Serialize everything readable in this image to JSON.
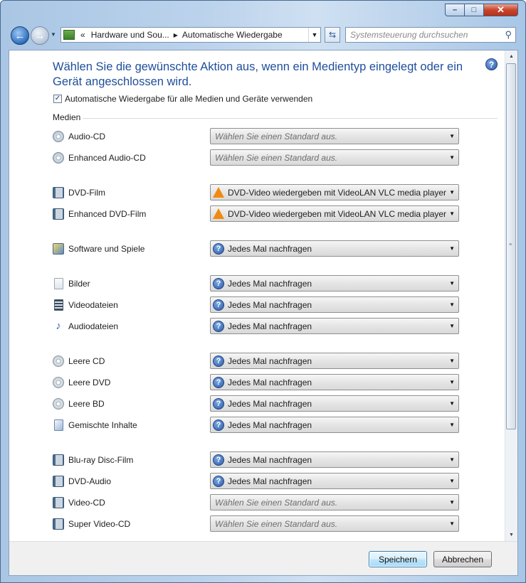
{
  "window": {
    "caption": {
      "minimize": "–",
      "maximize": "□",
      "close": "✕"
    }
  },
  "nav": {
    "back_glyph": "←",
    "forward_glyph": "→",
    "breadcrumb_prefix": "«",
    "breadcrumb": [
      "Hardware und Sou...",
      "Automatische Wiedergabe"
    ],
    "search_placeholder": "Systemsteuerung durchsuchen"
  },
  "header": {
    "title": "Wählen Sie die gewünschte Aktion aus, wenn ein Medientyp eingelegt oder ein Gerät angeschlossen wird.",
    "autoplay_checkbox_label": "Automatische Wiedergabe für alle Medien und Geräte verwenden",
    "autoplay_checked": true
  },
  "section": {
    "label": "Medien"
  },
  "rows": [
    {
      "label": "Audio-CD",
      "icon": "audio-cd-icon",
      "value": "Wählen Sie einen Standard aus.",
      "kind": "placeholder"
    },
    {
      "label": "Enhanced Audio-CD",
      "icon": "enhanced-audio-cd-icon",
      "value": "Wählen Sie einen Standard aus.",
      "kind": "placeholder"
    },
    {
      "label": "DVD-Film",
      "icon": "dvd-film-icon",
      "value": "DVD-Video wiedergeben mit VideoLAN VLC media player",
      "kind": "vlc"
    },
    {
      "label": "Enhanced DVD-Film",
      "icon": "enhanced-dvd-film-icon",
      "value": "DVD-Video wiedergeben mit VideoLAN VLC media player",
      "kind": "vlc"
    },
    {
      "label": "Software und Spiele",
      "icon": "software-games-icon",
      "value": "Jedes Mal nachfragen",
      "kind": "ask"
    },
    {
      "label": "Bilder",
      "icon": "pictures-icon",
      "value": "Jedes Mal nachfragen",
      "kind": "ask"
    },
    {
      "label": "Videodateien",
      "icon": "video-files-icon",
      "value": "Jedes Mal nachfragen",
      "kind": "ask"
    },
    {
      "label": "Audiodateien",
      "icon": "audio-files-icon",
      "value": "Jedes Mal nachfragen",
      "kind": "ask"
    },
    {
      "label": "Leere CD",
      "icon": "blank-cd-icon",
      "value": "Jedes Mal nachfragen",
      "kind": "ask"
    },
    {
      "label": "Leere DVD",
      "icon": "blank-dvd-icon",
      "value": "Jedes Mal nachfragen",
      "kind": "ask"
    },
    {
      "label": "Leere BD",
      "icon": "blank-bd-icon",
      "value": "Jedes Mal nachfragen",
      "kind": "ask"
    },
    {
      "label": "Gemischte Inhalte",
      "icon": "mixed-content-icon",
      "value": "Jedes Mal nachfragen",
      "kind": "ask"
    },
    {
      "label": "Blu-ray Disc-Film",
      "icon": "bluray-film-icon",
      "value": "Jedes Mal nachfragen",
      "kind": "ask"
    },
    {
      "label": "DVD-Audio",
      "icon": "dvd-audio-icon",
      "value": "Jedes Mal nachfragen",
      "kind": "ask"
    },
    {
      "label": "Video-CD",
      "icon": "video-cd-icon",
      "value": "Wählen Sie einen Standard aus.",
      "kind": "placeholder"
    },
    {
      "label": "Super Video-CD",
      "icon": "super-video-cd-icon",
      "value": "Wählen Sie einen Standard aus.",
      "kind": "placeholder"
    }
  ],
  "buttons": {
    "save": "Speichern",
    "cancel": "Abbrechen"
  }
}
